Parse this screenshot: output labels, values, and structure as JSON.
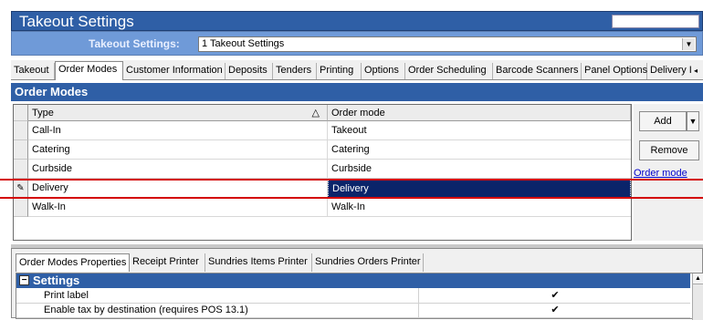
{
  "window": {
    "title": "Takeout Settings"
  },
  "selector": {
    "label": "Takeout Settings:",
    "value": "1 Takeout Settings"
  },
  "tabs": [
    {
      "label": "Takeout",
      "active": false
    },
    {
      "label": "Order Modes",
      "active": true
    },
    {
      "label": "Customer Information",
      "active": false
    },
    {
      "label": "Deposits",
      "active": false
    },
    {
      "label": "Tenders",
      "active": false
    },
    {
      "label": "Printing",
      "active": false
    },
    {
      "label": "Options",
      "active": false
    },
    {
      "label": "Order Scheduling",
      "active": false
    },
    {
      "label": "Barcode Scanners",
      "active": false
    },
    {
      "label": "Panel Options",
      "active": false
    },
    {
      "label": "Delivery I",
      "active": false
    }
  ],
  "tab_scroll_glyph": "◂",
  "order_modes": {
    "header": "Order Modes",
    "columns": {
      "type": "Type",
      "sort_glyph": "△",
      "mode": "Order mode"
    },
    "rows": [
      {
        "type": "Call-In",
        "mode": "Takeout"
      },
      {
        "type": "Catering",
        "mode": "Catering"
      },
      {
        "type": "Curbside",
        "mode": "Curbside"
      },
      {
        "type": "Delivery",
        "mode": "Delivery",
        "editing": true
      },
      {
        "type": "Walk-In",
        "mode": "Walk-In"
      }
    ],
    "edit_glyph": "✎"
  },
  "actions": {
    "add": "Add",
    "add_dropdown": "▼",
    "remove": "Remove",
    "link": "Order mode"
  },
  "properties": {
    "tabs": [
      "Order Modes Properties",
      "Receipt Printer",
      "Sundries Items Printer",
      "Sundries Orders Printer"
    ],
    "section": "Settings",
    "collapse_glyph": "−",
    "rows": [
      {
        "label": "Print label",
        "checked": "✔"
      },
      {
        "label": "Enable tax by destination (requires POS 13.1)",
        "checked": "✔"
      }
    ],
    "scroll_up_glyph": "▲"
  },
  "colors": {
    "title_bar": "#2f5fa6",
    "selector_bar": "#6f9ad8",
    "selection": "#0a246a",
    "highlight_line": "#d40000"
  }
}
